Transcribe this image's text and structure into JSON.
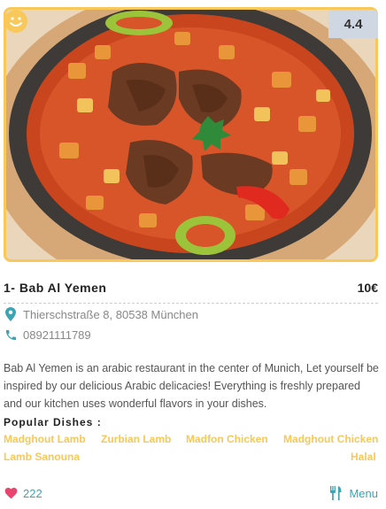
{
  "restaurant": {
    "rating": "4.4",
    "title": "1- Bab Al Yemen",
    "price": "10€",
    "address": "Thierschstraße 8, 80538 München",
    "phone": "08921111789",
    "description": "Bab Al Yemen is an arabic restaurant in the center of Munich, Let yourself be inspired by our delicious Arabic delicacies! Everything is freshly prepared and our kitchen uses wonderful flavors in your dishes.",
    "popular_label": "Popular Dishes :",
    "dishes": [
      "Madghout Lamb",
      "Zurbian Lamb",
      "Madfon Chicken",
      "Madghout Chicken",
      "Lamb Sanouna",
      "Halal"
    ],
    "likes": "222",
    "menu_label": "Menu"
  },
  "icons": {
    "smiley": "smiley-icon",
    "location": "location-pin-icon",
    "phone": "phone-icon",
    "heart": "heart-icon",
    "menu": "fork-knife-icon"
  },
  "colors": {
    "accent_yellow": "#f8c85a",
    "accent_teal": "#3aa6b3",
    "heart_pink": "#e8456e",
    "rating_bg": "#cfd8e2"
  }
}
